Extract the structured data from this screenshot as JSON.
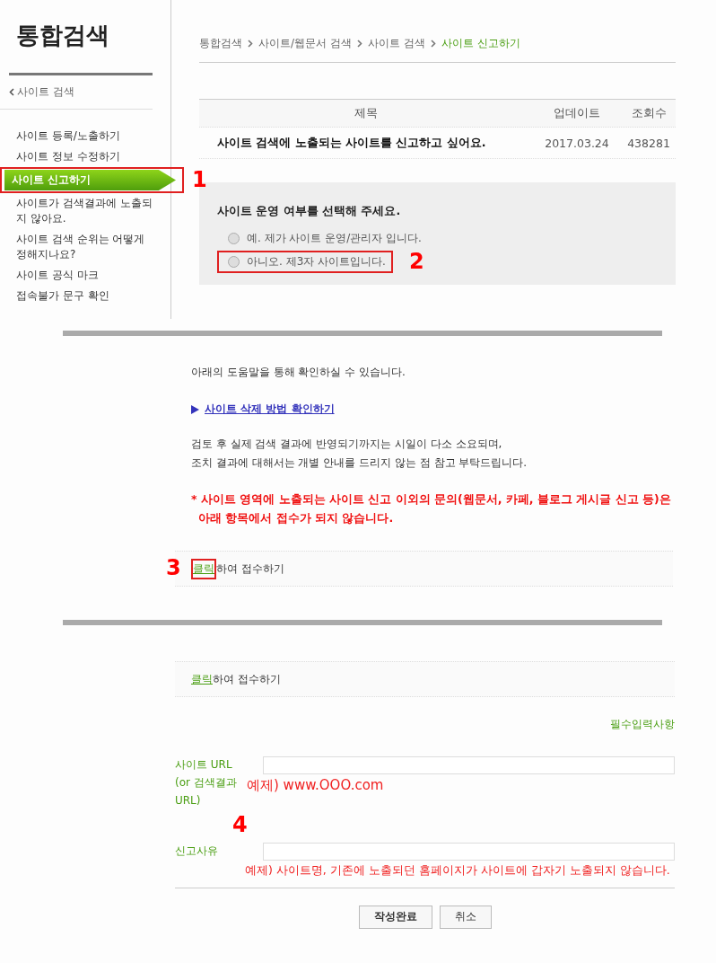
{
  "sidebar": {
    "title": "통합검색",
    "back": "사이트 검색",
    "items": [
      {
        "label": "사이트 등록/노출하기",
        "selected": false
      },
      {
        "label": "사이트 정보 수정하기",
        "selected": false
      },
      {
        "label": "사이트 신고하기",
        "selected": true,
        "annotation": "1"
      },
      {
        "label": "사이트가 검색결과에 노출되지 않아요.",
        "selected": false
      },
      {
        "label": "사이트 검색 순위는 어떻게 정해지나요?",
        "selected": false
      },
      {
        "label": "사이트 공식 마크",
        "selected": false
      },
      {
        "label": "접속불가 문구 확인",
        "selected": false
      }
    ]
  },
  "breadcrumb": [
    {
      "label": "통합검색",
      "selected": false
    },
    {
      "label": "사이트/웹문서 검색",
      "selected": false
    },
    {
      "label": "사이트 검색",
      "selected": false
    },
    {
      "label": "사이트 신고하기",
      "selected": true
    }
  ],
  "table": {
    "columns": [
      "제목",
      "업데이트",
      "조회수"
    ],
    "rows": [
      {
        "cells": [
          "사이트 검색에 노출되는 사이트를 신고하고 싶어요.",
          "2017.03.24",
          "438281"
        ]
      }
    ]
  },
  "question": {
    "title": "사이트 운영 여부를 선택해 주세요.",
    "options": [
      {
        "label": "예. 제가 사이트 운영/관리자 입니다.",
        "selected": false
      },
      {
        "label": "아니오. 제3자 사이트입니다.",
        "selected": false,
        "annotation": "2"
      }
    ]
  },
  "help": {
    "text": "아래의 도움말을 통해 확인하실 수 있습니다.",
    "link": "사이트 삭제 방법 확인하기",
    "notice": [
      "검토 후 실제 검색 결과에 반영되기까지는 시일이 다소 소요되며,",
      "조치 결과에 대해서는 개별 안내를 드리지 않는 점 참고 부탁드립니다."
    ],
    "warning": [
      "* 사이트 영역에 노출되는 사이트 신고 이외의 문의(웹문서, 카페, 블로그 게시글 신고 등)은",
      "아래 항목에서 접수가 되지 않습니다."
    ],
    "apply": {
      "link": "클릭",
      "text": "하여 접수하기",
      "annotation": "3"
    }
  },
  "form": {
    "apply": {
      "link": "클릭",
      "text": "하여 접수하기"
    },
    "required": "필수입력사항",
    "fields": [
      {
        "label": [
          "사이트 URL",
          "(or 검색결과",
          "URL)"
        ],
        "example": "예제) www.OOO.com"
      },
      {
        "label": [
          "신고사유"
        ],
        "example": "예제) 사이트명, 기존에 노출되던 홈페이지가 사이트에 갑자기 노출되지 않습니다.",
        "annotation": "4"
      }
    ],
    "buttons": [
      "작성완료",
      "취소"
    ]
  }
}
